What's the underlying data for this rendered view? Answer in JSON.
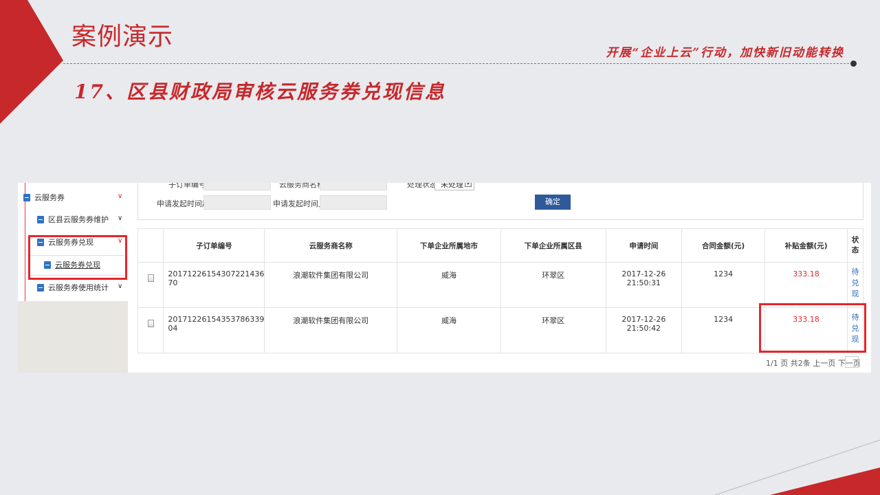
{
  "slide": {
    "title": "案例演示",
    "slogan": "开展“企业上云”行动，加快新旧动能转换",
    "subtitle": "17、区县财政局审核云服务券兑现信息"
  },
  "colors": {
    "accent": "#c7282b",
    "highlight": "#e4262b",
    "button": "#2e5a9c"
  },
  "sidebar": {
    "items": [
      {
        "label": "云服务券",
        "icon": "folder-icon"
      },
      {
        "label": "区县云服务券维护",
        "icon": "folder-icon"
      },
      {
        "label": "云服务券兑现",
        "icon": "folder-icon"
      },
      {
        "label": "云服务券兑现",
        "icon": "file-icon"
      },
      {
        "label": "云服务券使用统计",
        "icon": "folder-icon"
      }
    ]
  },
  "filter": {
    "order_no_label": "子订单编号",
    "provider_label": "云服务商名称",
    "status_label": "处理状态",
    "status_value": "未处理",
    "start_label": "申请发起时间起",
    "end_label": "申请发起时间止",
    "confirm": "确定"
  },
  "table": {
    "headers": [
      "子订单编号",
      "云服务商名称",
      "下单企业所属地市",
      "下单企业所属区县",
      "申请时间",
      "合同金额(元)",
      "补贴金额(元)",
      "状态"
    ],
    "rows": [
      {
        "order_no": "20171226154307221436 70",
        "provider": "浪潮软件集团有限公司",
        "city": "威海",
        "district": "环翠区",
        "time": "2017-12-26 21:50:31",
        "contract": "1234",
        "subsidy": "333.18",
        "status": "待兑现"
      },
      {
        "order_no": "20171226154353786339 04",
        "provider": "浪潮软件集团有限公司",
        "city": "威海",
        "district": "环翠区",
        "time": "2017-12-26 21:50:42",
        "contract": "1234",
        "subsidy": "333.18",
        "status": "待兑现"
      }
    ]
  },
  "pager": {
    "text": "1/1 页 共2条 上一页 下一页"
  }
}
